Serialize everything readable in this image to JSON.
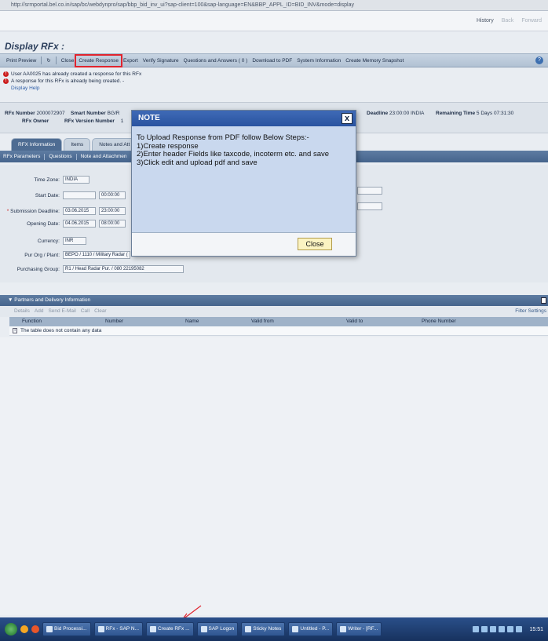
{
  "browser": {
    "address": "http://srmportal.bel.co.in/sap/bc/webdynpro/sap/bbp_bid_inv_ui?sap-client=100&sap-language=EN&BBP_APPL_ID=BID_INV&mode=display",
    "host": "srmportal.bel.co.in"
  },
  "portal": {
    "history": "History",
    "back": "Back",
    "forward": "Forward"
  },
  "page": {
    "title": "Display RFx :"
  },
  "toolbar": {
    "print_preview": "Print Preview",
    "close": "Close",
    "create_response": "Create Response",
    "export": "Export",
    "verify_signature": "Verify Signature",
    "qa": "Questions and Answers ( 0 )",
    "download_pdf": "Download to PDF",
    "system_info": "System Information",
    "memory_snapshot": "Create Memory Snapshot"
  },
  "messages": {
    "msg1": "User AA0025 has already created a response for this RFx",
    "msg2": "A response for this RFx is already being created. -",
    "help": "Display Help"
  },
  "header": {
    "rfx_number_label": "RFx Number",
    "rfx_number": "2000072907",
    "smart_number_label": "Smart Number",
    "smart_number": "BG/R",
    "rfx_owner_label": "RFx Owner",
    "version_label": "RFx Version Number",
    "version": "1",
    "deadline_label": "Deadline",
    "deadline": "23:00:00 INDIA",
    "remaining_label": "Remaining Time",
    "remaining": "5 Days 07:31:30"
  },
  "tabs": {
    "rfx_info": "RFX Information",
    "items": "Items",
    "notes": "Notes and Att"
  },
  "subtabs": {
    "params": "RFx Parameters",
    "questions": "Questions",
    "notes": "Note and Attachmen"
  },
  "form": {
    "timezone_label": "Time Zone:",
    "timezone": "INDIA",
    "start_label": "Start Date:",
    "start_date": "",
    "start_time": "00:00:00",
    "submission_label": "Submission Deadline:",
    "submission_date": "03.06.2015",
    "submission_time": "23:00:00",
    "opening_label": "Opening Date:",
    "opening_date": "04.06.2015",
    "opening_time": "08:00:00",
    "currency_label": "Currency:",
    "currency": "INR",
    "purorg_label": "Pur Org / Plant:",
    "purorg": "BEPO / 1110 / Military Radar (",
    "purgroup_label": "Purchasing Group:",
    "purgroup": "R1 / Head Radar Pur. / 080 22195082"
  },
  "partners": {
    "title": "Partners and Delivery Information",
    "details": "Details",
    "add": "Add",
    "send_email": "Send E-Mail",
    "call": "Call",
    "clear": "Clear",
    "filter": "Filter Settings",
    "columns": [
      "Function",
      "Number",
      "Name",
      "Valid from",
      "Valid to",
      "Phone Number"
    ],
    "empty": "The table does not contain any data"
  },
  "modal": {
    "title": "NOTE",
    "close_x": "x",
    "intro": "To Upload Response from PDF follow Below Steps:-",
    "step1": "1)Create response",
    "step2": "2)Enter header Fields like taxcode, incoterm etc. and save",
    "step3": "3)Click edit and upload pdf and save",
    "close_button": "Close"
  },
  "taskbar": {
    "items": [
      "Bid Processi...",
      "RFx - SAP N...",
      "Create RFx ...",
      "SAP Logon",
      "Sticky Notes",
      "Untitled - P...",
      "Writer - [RF..."
    ],
    "clock": "15:51"
  }
}
